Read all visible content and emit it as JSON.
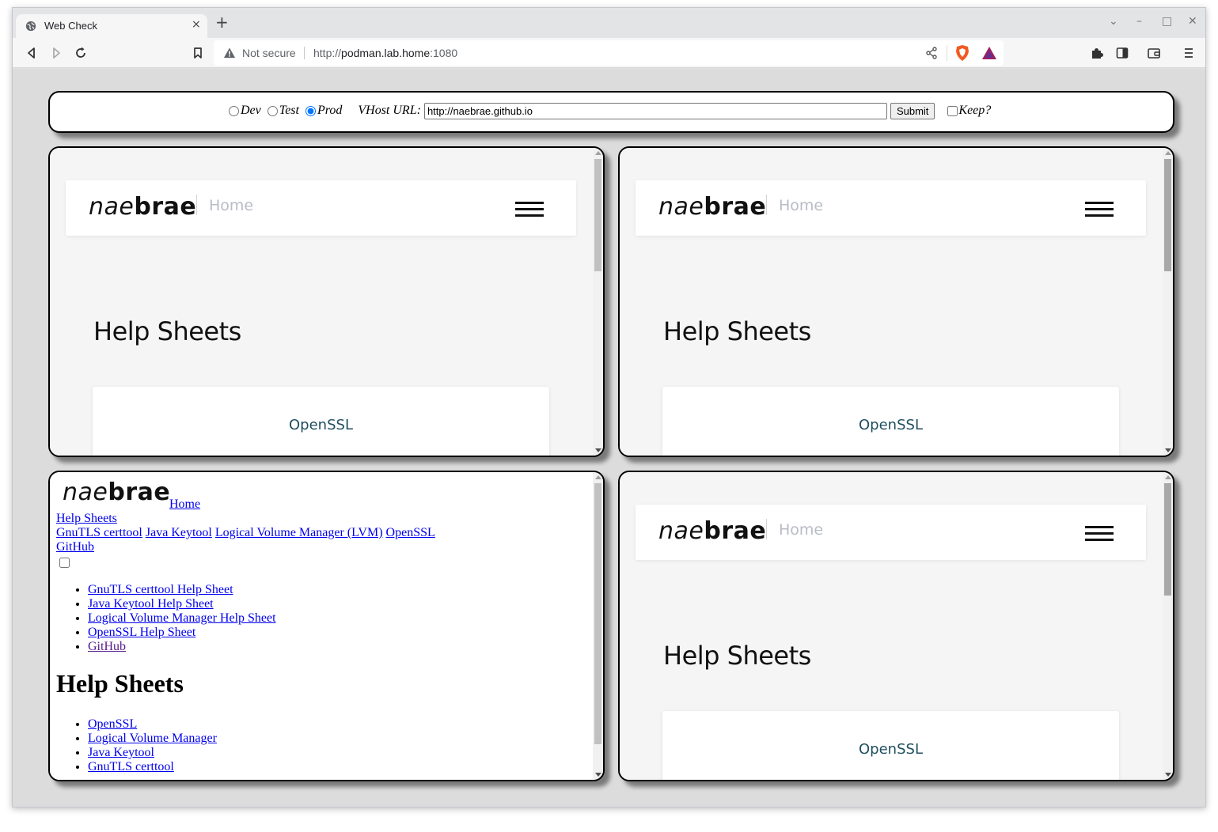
{
  "browser": {
    "tab_title": "Web Check",
    "tab_close": "×",
    "new_tab": "+",
    "window_controls": {
      "dropdown": "⌄",
      "minimize": "–",
      "maximize": "□",
      "close": "✕"
    },
    "security_label": "Not secure",
    "url_scheme": "http://",
    "url_host": "podman.lab.home",
    "url_port": ":1080",
    "icons": [
      "back-icon",
      "forward-icon",
      "reload-icon",
      "bookmark-icon",
      "share-icon",
      "brave-shields-icon",
      "brave-rewards-icon",
      "extensions-icon",
      "sidebar-icon",
      "wallet-icon",
      "menu-icon"
    ]
  },
  "controls": {
    "env_options": [
      "Dev",
      "Test",
      "Prod"
    ],
    "env_selected": "Prod",
    "vhost_label": "VHost URL:",
    "vhost_value": "http://naebrae.github.io",
    "submit_label": "Submit",
    "keep_label": "Keep?",
    "keep_checked": false
  },
  "site": {
    "logo_nae": "nae",
    "logo_brae": "brae",
    "home_label": "Home",
    "heading": "Help Sheets",
    "card_link": "OpenSSL"
  },
  "raw_frame": {
    "home_label": " Home",
    "help_sheets_link": "Help Sheets",
    "nav_links": [
      "GnuTLS certtool",
      "Java Keytool",
      "Logical Volume Manager (LVM)",
      "OpenSSL"
    ],
    "github_link": "GitHub",
    "menu_list": [
      "GnuTLS certtool Help Sheet",
      "Java Keytool Help Sheet",
      "Logical Volume Manager Help Sheet",
      "OpenSSL Help Sheet",
      "GitHub"
    ],
    "heading": "Help Sheets",
    "sheets_list": [
      "OpenSSL",
      "Logical Volume Manager",
      "Java Keytool",
      "GnuTLS certtool"
    ]
  },
  "colors": {
    "link": "#0000ee",
    "visited": "#551a8b",
    "card_link": "#1f4e5f",
    "nav_home": "#b8bcc4"
  }
}
